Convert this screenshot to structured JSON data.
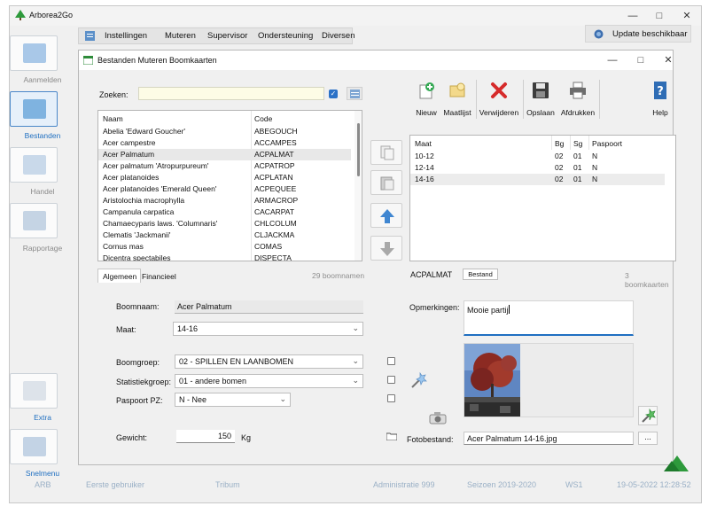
{
  "app": {
    "title": "Arborea2Go",
    "update_label": "Update beschikbaar"
  },
  "nav": {
    "items": [
      {
        "label": "Aanmelden",
        "active": false
      },
      {
        "label": "Bestanden",
        "active": true
      },
      {
        "label": "Handel",
        "active": false
      },
      {
        "label": "Rapportage",
        "active": false
      }
    ],
    "extra_label": "Extra",
    "snelmenu_label": "Snelmenu"
  },
  "menu": {
    "items": [
      "Instellingen",
      "Muteren",
      "Supervisor",
      "Ondersteuning",
      "Diversen"
    ]
  },
  "dialog": {
    "title": "Bestanden Muteren Boomkaarten",
    "search_label": "Zoeken:",
    "search_value": "",
    "tree_headers": {
      "name": "Naam",
      "code": "Code"
    },
    "trees": [
      {
        "name": "Abelia 'Edward Goucher'",
        "code": "ABEGOUCH"
      },
      {
        "name": "Acer campestre",
        "code": "ACCAMPES"
      },
      {
        "name": "Acer Palmatum",
        "code": "ACPALMAT",
        "selected": true
      },
      {
        "name": "Acer palmatum 'Atropurpureum'",
        "code": "ACPATROP"
      },
      {
        "name": "Acer platanoides",
        "code": "ACPLATAN"
      },
      {
        "name": "Acer platanoides 'Emerald Queen'",
        "code": "ACPEQUEE"
      },
      {
        "name": "Aristolochia macrophylla",
        "code": "ARMACROP"
      },
      {
        "name": "Campanula carpatica",
        "code": "CACARPAT"
      },
      {
        "name": "Chamaecyparis laws. 'Columnaris'",
        "code": "CHLCOLUM"
      },
      {
        "name": "Clematis 'Jackmanii'",
        "code": "CLJACKMA"
      },
      {
        "name": "Cornus mas",
        "code": "COMAS"
      },
      {
        "name": "Dicentra spectabiles",
        "code": "DISPECTA"
      }
    ],
    "tree_count": "29 boomnamen",
    "tabs": [
      "Algemeen",
      "Financieel"
    ],
    "toolbar": [
      "Nieuw",
      "Maatlijst",
      "Verwijderen",
      "Opslaan",
      "Afdrukken",
      "Help"
    ],
    "size_headers": {
      "maat": "Maat",
      "bg": "Bg",
      "sg": "Sg",
      "paspoort": "Paspoort"
    },
    "sizes": [
      {
        "maat": "10-12",
        "bg": "02",
        "sg": "01",
        "paspoort": "N"
      },
      {
        "maat": "12-14",
        "bg": "02",
        "sg": "01",
        "paspoort": "N"
      },
      {
        "maat": "14-16",
        "bg": "02",
        "sg": "01",
        "paspoort": "N",
        "selected": true
      }
    ],
    "current_code": "ACPALMAT",
    "bestand_button": "Bestand",
    "card_count": "3 boomkaarten",
    "form": {
      "boomnaam_label": "Boomnaam:",
      "boomnaam_value": "Acer Palmatum",
      "maat_label": "Maat:",
      "maat_value": "14-16",
      "boomgroep_label": "Boomgroep:",
      "boomgroep_value": "02 - SPILLEN EN LAANBOMEN",
      "statistiek_label": "Statistiekgroep:",
      "statistiek_value": "01 - andere bomen",
      "paspoort_label": "Paspoort PZ:",
      "paspoort_value": "N - Nee",
      "gewicht_label": "Gewicht:",
      "gewicht_value": "150",
      "gewicht_unit": "Kg",
      "opmerkingen_label": "Opmerkingen:",
      "opmerkingen_value": "Mooie partij",
      "foto_label": "Fotobestand:",
      "foto_value": "Acer Palmatum 14-16.jpg",
      "browse_label": "..."
    }
  },
  "status": {
    "items": [
      "ARB",
      "Eerste gebruiker",
      "Tribum",
      "Administratie 999",
      "Seizoen 2019-2020",
      "WS1",
      "19-05-2022 12:28:52"
    ]
  },
  "colors": {
    "accent": "#1f6fc1",
    "nav_active_border": "#4a87c9",
    "delete_red": "#d62b2b"
  }
}
